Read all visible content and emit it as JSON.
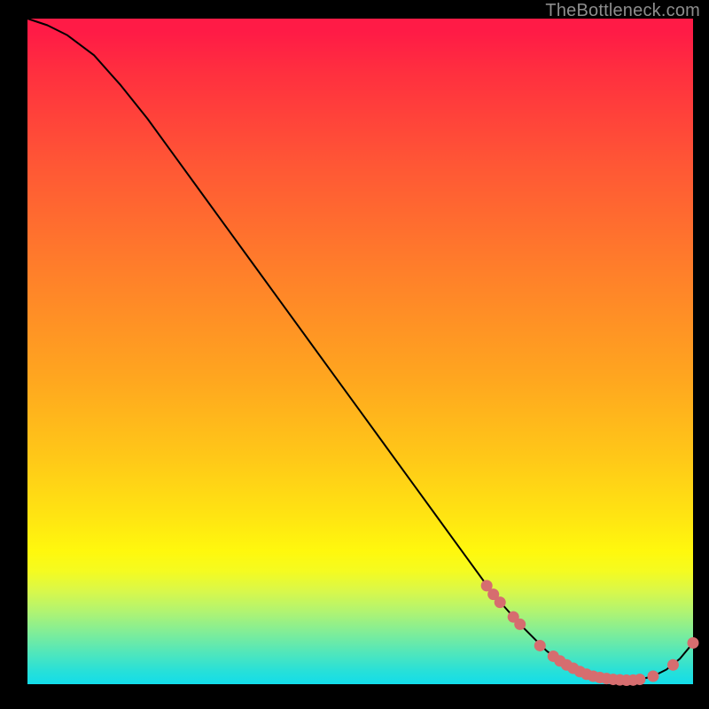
{
  "watermark": "TheBottleneck.com",
  "chart_data": {
    "type": "line",
    "title": "",
    "xlabel": "",
    "ylabel": "",
    "xlim": [
      0,
      100
    ],
    "ylim": [
      0,
      100
    ],
    "grid": false,
    "x": [
      0,
      3,
      6,
      10,
      14,
      18,
      22,
      26,
      30,
      34,
      38,
      42,
      46,
      50,
      54,
      58,
      62,
      66,
      70,
      74,
      78,
      80,
      82,
      84,
      86,
      88,
      90,
      92,
      94,
      96,
      98,
      100
    ],
    "values": [
      100,
      99,
      97.5,
      94.5,
      90,
      85,
      79.5,
      74,
      68.5,
      63,
      57.5,
      52,
      46.5,
      41,
      35.5,
      30,
      24.5,
      19,
      13.5,
      9,
      5,
      3.5,
      2.3,
      1.5,
      1,
      0.7,
      0.6,
      0.7,
      1.2,
      2.2,
      3.8,
      6.2
    ],
    "highlight_points": [
      {
        "x": 69,
        "y": 14.8
      },
      {
        "x": 70,
        "y": 13.5
      },
      {
        "x": 71,
        "y": 12.3
      },
      {
        "x": 73,
        "y": 10.1
      },
      {
        "x": 74,
        "y": 9.0
      },
      {
        "x": 77,
        "y": 5.8
      },
      {
        "x": 79,
        "y": 4.2
      },
      {
        "x": 80,
        "y": 3.5
      },
      {
        "x": 81,
        "y": 2.9
      },
      {
        "x": 82,
        "y": 2.4
      },
      {
        "x": 83,
        "y": 1.9
      },
      {
        "x": 84,
        "y": 1.5
      },
      {
        "x": 85,
        "y": 1.2
      },
      {
        "x": 86,
        "y": 1.0
      },
      {
        "x": 87,
        "y": 0.85
      },
      {
        "x": 88,
        "y": 0.72
      },
      {
        "x": 89,
        "y": 0.65
      },
      {
        "x": 90,
        "y": 0.6
      },
      {
        "x": 91,
        "y": 0.62
      },
      {
        "x": 92,
        "y": 0.72
      },
      {
        "x": 94,
        "y": 1.2
      },
      {
        "x": 97,
        "y": 2.9
      },
      {
        "x": 100,
        "y": 6.2
      }
    ],
    "colors": {
      "line": "#000000",
      "marker_fill": "#d66d6f",
      "marker_stroke": "#d66d6f"
    }
  }
}
